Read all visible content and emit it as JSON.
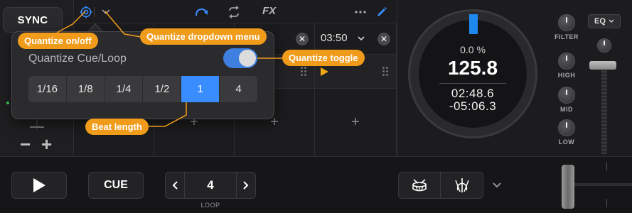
{
  "app": {
    "sync_label": "SYNC",
    "pitch_minus": "−",
    "pitch_plus": "+"
  },
  "toolbar": {
    "quantize_icon": "quantize-target-icon",
    "dropdown_icon": "chevron-down-icon",
    "fx_label": "FX",
    "icons": [
      "quantize-target-icon",
      "chevron-down-icon",
      "reverse-arrow-icon",
      "loop-arrows-icon",
      "more-dots-icon",
      "edit-pencil-icon"
    ]
  },
  "pads": [
    {
      "time": "",
      "has_close": false,
      "state": "empty"
    },
    {
      "time": "",
      "has_close": false,
      "state": "empty"
    },
    {
      "time": "",
      "has_close": true,
      "state": "empty"
    },
    {
      "time": "03:50",
      "has_close": true,
      "state": "playing"
    }
  ],
  "pads_add_label": "+",
  "deck": {
    "pitch_percent": "0.0 %",
    "bpm": "125.8",
    "elapsed": "02:48.6",
    "remaining": "-05:06.3",
    "filter_label": "FILTER",
    "high_label": "HIGH",
    "mid_label": "MID",
    "low_label": "LOW",
    "eq_label": "EQ",
    "accent_color": "#1e88f0"
  },
  "popover": {
    "title": "Quantize Cue/Loop",
    "toggle_on": true,
    "options": [
      "1/16",
      "1/8",
      "1/4",
      "1/2",
      "1",
      "4"
    ],
    "selected": "1"
  },
  "bottom": {
    "play_icon": "play-icon",
    "cue_label": "CUE",
    "loop_value": "4",
    "loop_label": "LOOP",
    "drum_icon": "drum-icon",
    "instrument_icon": "instruments-icon"
  },
  "annotations": {
    "quantize_onoff": "Quantize on/off",
    "quantize_dropdown": "Quantize dropdown menu",
    "quantize_toggle": "Quantize toggle",
    "beat_length": "Beat length",
    "callout_color": "#f19b1a"
  }
}
